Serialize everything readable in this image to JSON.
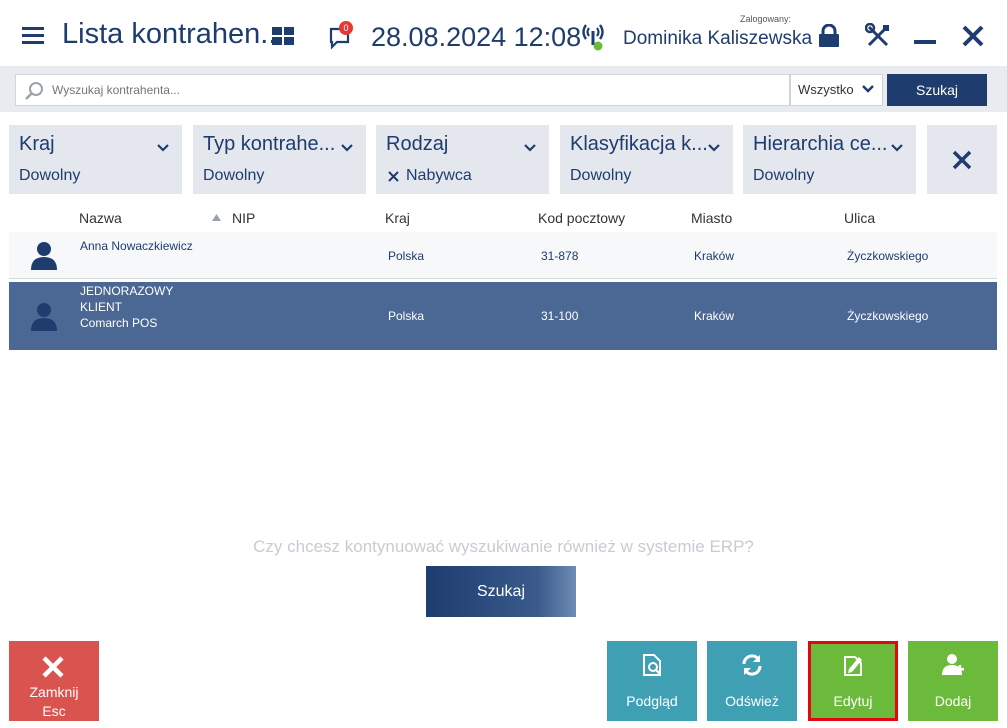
{
  "header": {
    "title": "Lista kontrahen...",
    "notification_count": "0",
    "datetime": "28.08.2024 12:08",
    "logged_label": "Zalogowany:",
    "user_name": "Dominika Kaliszewska"
  },
  "search": {
    "placeholder": "Wyszukaj kontrahenta...",
    "scope": "Wszystko",
    "button": "Szukaj"
  },
  "filters": [
    {
      "label": "Kraj",
      "value": "Dowolny"
    },
    {
      "label": "Typ kontrahe...",
      "value": "Dowolny"
    },
    {
      "label": "Rodzaj",
      "value": "Nabywca",
      "removable": true
    },
    {
      "label": "Klasyfikacja k...",
      "value": "Dowolny"
    },
    {
      "label": "Hierarchia ce...",
      "value": "Dowolny"
    }
  ],
  "table": {
    "columns": [
      "Nazwa",
      "NIP",
      "Kraj",
      "Kod pocztowy",
      "Miasto",
      "Ulica"
    ],
    "rows": [
      {
        "name": "Anna Nowaczkiewicz",
        "nip": "",
        "country": "Polska",
        "postal": "31-878",
        "city": "Kraków",
        "street": "Życzkowskiego",
        "selected": false
      },
      {
        "name_lines": [
          "JEDNORAZOWY",
          "KLIENT",
          "Comarch POS"
        ],
        "nip": "",
        "country": "Polska",
        "postal": "31-100",
        "city": "Kraków",
        "street": "Życzkowskiego",
        "selected": true
      }
    ]
  },
  "erp_prompt": "Czy chcesz kontynuować wyszukiwanie również w systemie ERP?",
  "erp_button": "Szukaj",
  "actions": {
    "close": [
      "Zamknij",
      "Esc"
    ],
    "preview": "Podgląd",
    "refresh": "Odśwież",
    "edit": "Edytuj",
    "add": "Dodaj"
  },
  "colors": {
    "brand": "#1e3c6e",
    "selected_row": "#4b6894",
    "danger": "#d9534f",
    "teal": "#3fa0b3",
    "green": "#6cba3b"
  }
}
